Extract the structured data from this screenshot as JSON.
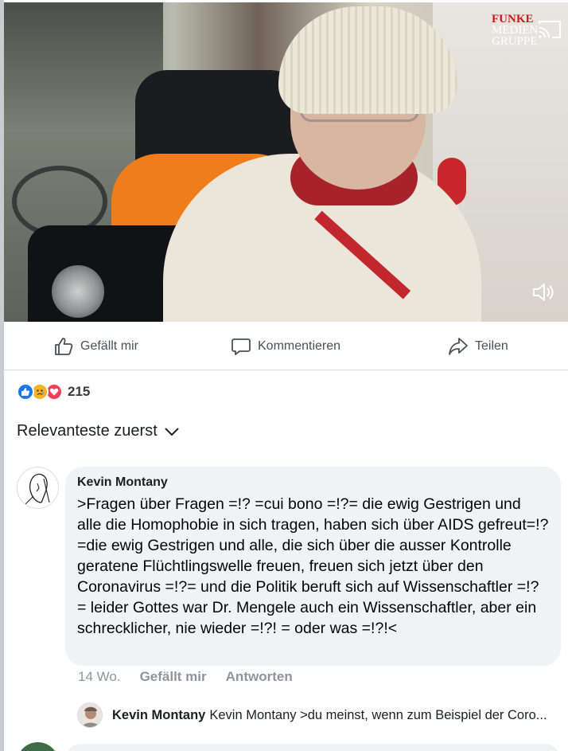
{
  "video": {
    "logo": {
      "line1": "FUNKE",
      "line2": "MEDIEN",
      "line3": "GRUPPE"
    },
    "icons": [
      "cast-icon",
      "sound-icon"
    ]
  },
  "actions": {
    "like_label": "Gefällt mir",
    "comment_label": "Kommentieren",
    "share_label": "Teilen"
  },
  "reactions": {
    "types": [
      "like",
      "sad",
      "love"
    ],
    "count": "215",
    "colors": {
      "like": "#1877f2",
      "sad": "#f7b125",
      "love": "#f33e58"
    }
  },
  "sort": {
    "label": "Relevanteste zuerst"
  },
  "comment": {
    "author": "Kevin Montany",
    "text": ">Fragen über Fragen =!? =cui bono =!?= die ewig Gestrigen und alle die Homophobie in sich tragen, haben sich über AIDS gefreut=!?=die ewig Gestrigen und alle, die sich über die ausser Kontrolle geratene Flüchtlingswelle  freuen, freuen sich jetzt über den Coronavirus  =!?= und die Politik beruft sich auf Wissenschaftler =!? = leider Gottes war  Dr. Mengele  auch ein Wissenschaftler, aber ein schrecklicher, nie wieder =!?! = oder was =!?!<",
    "time": "14 Wo.",
    "like_label": "Gefällt mir",
    "reply_label": "Antworten"
  },
  "reply_preview": {
    "author": "Kevin Montany",
    "text": "Kevin Montany >du meinst, wenn zum Beispiel der Coro..."
  }
}
